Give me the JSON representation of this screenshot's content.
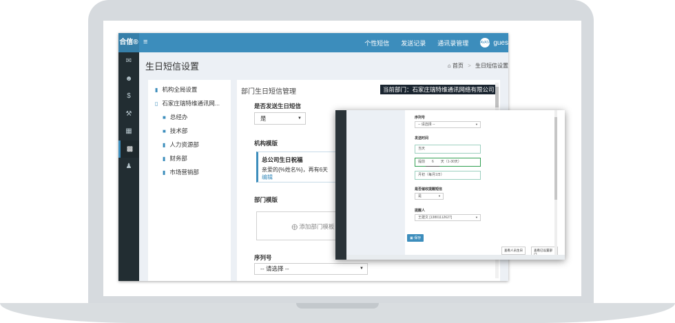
{
  "app": {
    "logo": "合信®",
    "hamburger": "≡",
    "nav": [
      "个性短信",
      "发送记录",
      "通讯录管理"
    ],
    "username": "gues",
    "avatar_text": "AVATAR"
  },
  "sidebar_icons": [
    "envelope-icon",
    "users-icon",
    "dollar-icon",
    "wrench-icon",
    "table-icon",
    "sitemap-icon",
    "user-icon"
  ],
  "page": {
    "title": "生日短信设置",
    "breadcrumb_home": "首页",
    "breadcrumb_current": "生日短信设置"
  },
  "tree": {
    "items": [
      {
        "label": "机构全局设置",
        "icon": "file-icon"
      },
      {
        "label": "石家庄瑞特维通讯网...",
        "icon": "folder-open-icon"
      },
      {
        "label": "总经办",
        "icon": "folder-icon"
      },
      {
        "label": "技术部",
        "icon": "folder-icon"
      },
      {
        "label": "人力资源部",
        "icon": "file-icon"
      },
      {
        "label": "财务部",
        "icon": "file-icon"
      },
      {
        "label": "市场营销部",
        "icon": "file-icon"
      }
    ]
  },
  "main": {
    "panel_title": "部门生日短信管理",
    "current_dept": "当前部门：石家庄瑞特维通讯网络有限公司",
    "send_label": "是否发送生日短信",
    "send_value": "是",
    "org_template_label": "机构模版",
    "template_title": "总公司生日祝福",
    "template_body": "亲爱的{%姓名%}，再有6天",
    "template_edit": "编辑",
    "dept_template_label": "部门模版",
    "add_template": "添加部门模板",
    "serial_label": "序列号",
    "serial_placeholder": "-- 请选择 --"
  },
  "overlay": {
    "serial_label": "序列号",
    "serial_placeholder": "-- 请选择 --",
    "send_time_label": "发送时间",
    "send_time_value": "当天",
    "advance_prefix": "提前",
    "advance_days": "6",
    "advance_suffix": "天（1-30天）",
    "monthly_value": "月初（每月1日）",
    "notify_label": "是否催收提醒短信",
    "notify_value": "是",
    "reminder_label": "提醒人",
    "reminder_value": "王建文 [13801112627]",
    "save_button": "保存",
    "view_birthday_button": "查看人员生日",
    "view_set_button": "查看已设置部门"
  }
}
